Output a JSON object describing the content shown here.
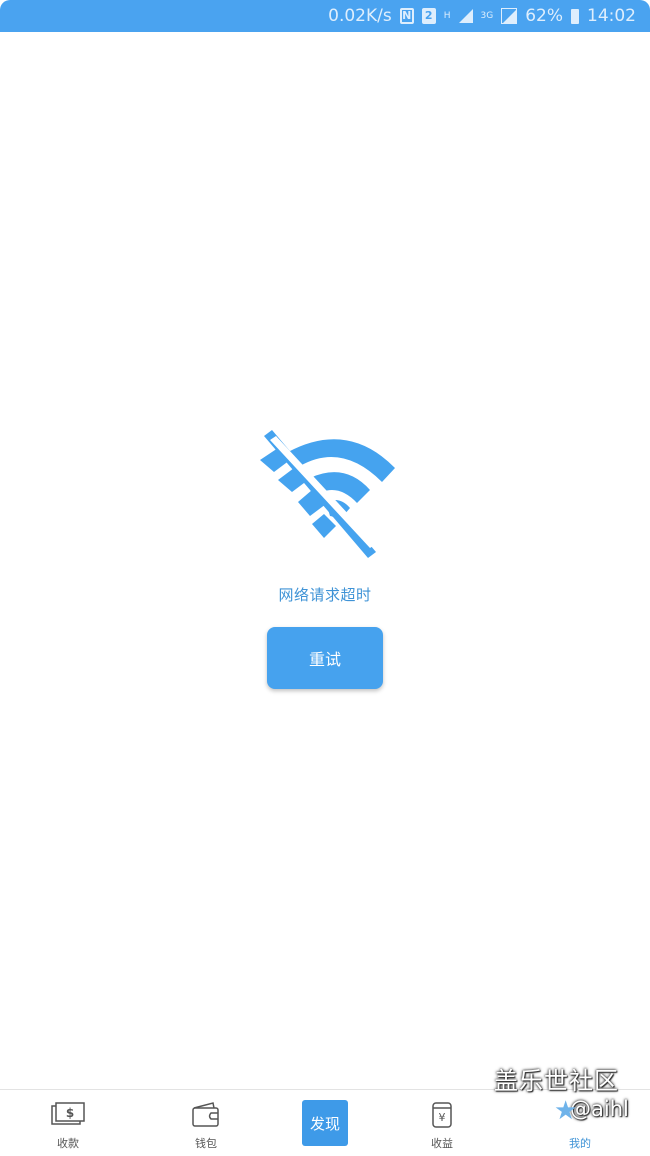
{
  "status_bar": {
    "speed": "0.02K/s",
    "sim_label": "2",
    "network_type": "3G",
    "hd_label": "H",
    "battery": "62%",
    "time": "14:02"
  },
  "error": {
    "icon": "wifi-off-icon",
    "message": "网络请求超时",
    "retry_label": "重试"
  },
  "bottom_nav": {
    "items": [
      {
        "label": "收款",
        "icon": "cash-icon"
      },
      {
        "label": "钱包",
        "icon": "wallet-icon"
      },
      {
        "label": "发现",
        "icon": "discover-button"
      },
      {
        "label": "收益",
        "icon": "yen-receipt-icon"
      },
      {
        "label": "我的",
        "icon": "profile-icon"
      }
    ],
    "active_index": 4
  },
  "watermark": {
    "title": "盖乐世社区",
    "user": "@aihl"
  },
  "colors": {
    "accent": "#4aa3f0",
    "button": "#46a2ee",
    "message": "#3f93d6"
  }
}
